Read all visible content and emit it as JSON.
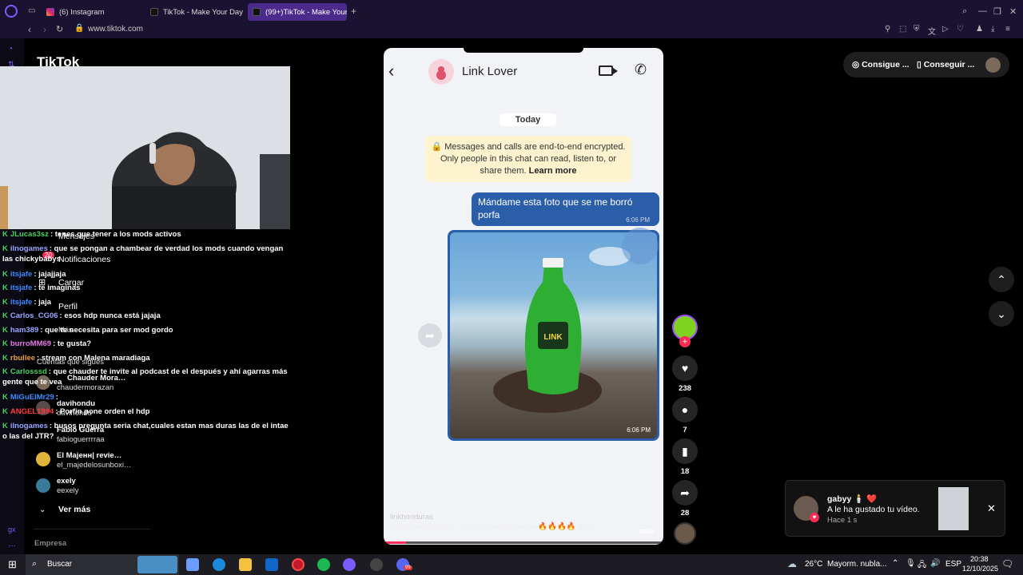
{
  "browser": {
    "tabs": [
      {
        "title": "(6) Instagram"
      },
      {
        "title": "TikTok - Make Your Day"
      },
      {
        "title": "(99+)TikTok - Make Your"
      }
    ],
    "url": "www.tiktok.com"
  },
  "tiktok": {
    "logo": "TikTok",
    "nav": [
      "Mensajes",
      "Notificaciones",
      "Cargar",
      "Perfil",
      "Más"
    ],
    "notifications_badge": "20",
    "following_header": "Cuentas que sigues",
    "following": [
      {
        "name": "Chauder Mora…",
        "handle": "chaudermorazan"
      },
      {
        "name": "davihondu",
        "handle": "davihondu"
      },
      {
        "name": "Fabio Guerra",
        "handle": "fabioguerrrraa"
      },
      {
        "name": "El Majeнн| revie…",
        "handle": "el_majedelosunboxi…"
      },
      {
        "name": "exely",
        "handle": "eexely"
      }
    ],
    "see_more": "Ver más",
    "company": "Empresa",
    "top_buttons": [
      "Consigue ...",
      "Conseguir ..."
    ]
  },
  "chat": [
    {
      "user": "JLucas3sz",
      "msg": ": tenes que tener a los mods activos",
      "color": "#46d160"
    },
    {
      "user": "ilnogames",
      "msg": ": que se pongan a chambear de verdad los mods cuando vengan las chickybabys",
      "color": "#9aa7ff"
    },
    {
      "user": "itsjafe",
      "msg": ": jajajjaja",
      "color": "#3b8cff"
    },
    {
      "user": "itsjafe",
      "msg": ": te imaginas",
      "color": "#3b8cff"
    },
    {
      "user": "itsjafe",
      "msg": ": jaja",
      "color": "#3b8cff"
    },
    {
      "user": "Carlos_CG06",
      "msg": ": esos hdp nunca está jajaja",
      "color": "#9aa7ff"
    },
    {
      "user": "ham389",
      "msg": ": que te necesita para ser mod gordo",
      "color": "#9aa7ff"
    },
    {
      "user": "burroMM69",
      "msg": ": te gusta?",
      "color": "#e77ae7"
    },
    {
      "user": "rbullee",
      "msg": ": stream con Malena maradiaga",
      "color": "#e8a23b"
    },
    {
      "user": "Carlosssd",
      "msg": ": que chauder te invite al podcast de el después y ahí agarras más gente que te vea",
      "color": "#46d160"
    },
    {
      "user": "MiGuElMr29",
      "msg": ": ",
      "color": "#3b8cff"
    },
    {
      "user": "ANGEL1994",
      "msg": ": Porfin pone orden el hdp",
      "color": "#ff3b3b"
    },
    {
      "user": "ilnogames",
      "msg": ": busos pregunta seria chat,cuales estan mas duras las de el intae o las del JTR?",
      "color": "#9aa7ff"
    }
  ],
  "phone": {
    "contact": "Link Lover",
    "date_chip": "Today",
    "e2e_text": "Messages and calls are end-to-end encrypted. Only people in this chat can read, listen to, or share them.",
    "e2e_link": "Learn more",
    "message": "Mándame esta foto que se me borró porfa",
    "msg_time": "6:06 PM",
    "photo_time": "6:06 PM",
    "bottle_label": "LINK",
    "caption_handle": "linkhonduras",
    "caption": "si les causó gracia , envíenlo para su racha 🔥🔥🔥🔥 #link ...",
    "caption_more": "más",
    "progress": 0.08
  },
  "actions": {
    "likes": "238",
    "comments": "7",
    "saves": "18",
    "shares": "28"
  },
  "toast": {
    "user": "gabyy 🕯️ ❤️",
    "text": "A le ha gustado tu vídeo.",
    "time": "Hace 1 s"
  },
  "taskbar": {
    "search": "Buscar",
    "weather_temp": "26°C",
    "weather_desc": "Mayorm. nubla...",
    "lang": "ESP",
    "time": "20:38",
    "date": "12/10/2025",
    "mail_badge": "99"
  }
}
